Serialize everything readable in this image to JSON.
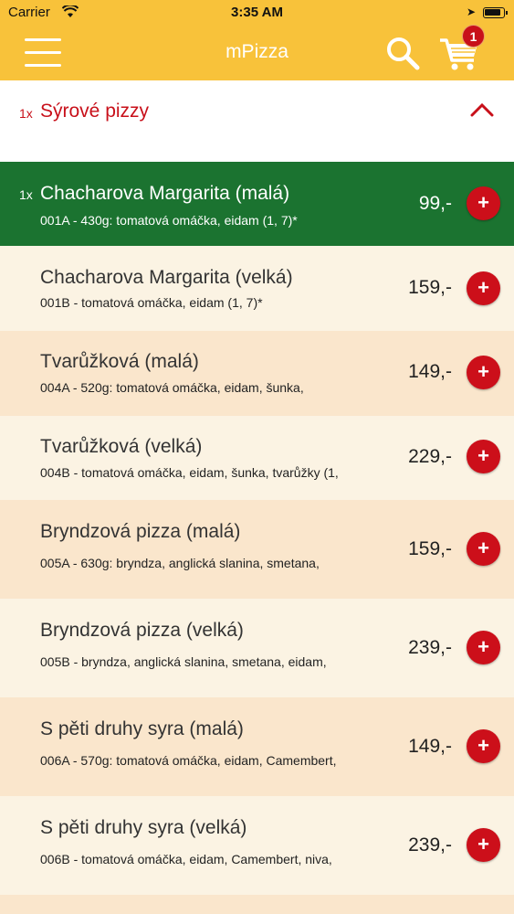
{
  "status": {
    "carrier": "Carrier",
    "time": "3:35 AM"
  },
  "header": {
    "title": "mPizza",
    "cart_count": "1",
    "accent": "#f8c23a"
  },
  "category": {
    "qty": "1x",
    "name": "Sýrové pizzy"
  },
  "items": [
    {
      "qty": "1x",
      "title": "Chacharova Margarita (malá)",
      "desc": "001A - 430g: tomatová omáčka, eidam (1, 7)*",
      "price": "99,-",
      "add": "+"
    },
    {
      "qty": "",
      "title": "Chacharova Margarita (velká)",
      "desc": "001B - tomatová omáčka, eidam (1, 7)*",
      "price": "159,-",
      "add": "+"
    },
    {
      "qty": "",
      "title": "Tvarůžková (malá)",
      "desc": "004A - 520g: tomatová omáčka, eidam, šunka,",
      "price": "149,-",
      "add": "+"
    },
    {
      "qty": "",
      "title": "Tvarůžková (velká)",
      "desc": "004B - tomatová omáčka, eidam, šunka, tvarůžky (1,",
      "price": "229,-",
      "add": "+"
    },
    {
      "qty": "",
      "title": "Bryndzová pizza (malá)",
      "desc": "005A - 630g: bryndza, anglická slanina, smetana,",
      "price": "159,-",
      "add": "+"
    },
    {
      "qty": "",
      "title": "Bryndzová pizza (velká)",
      "desc": "005B - bryndza, anglická slanina, smetana, eidam,",
      "price": "239,-",
      "add": "+"
    },
    {
      "qty": "",
      "title": "S pěti druhy syra (malá)",
      "desc": "006A - 570g: tomatová omáčka, eidam, Camembert,",
      "price": "149,-",
      "add": "+"
    },
    {
      "qty": "",
      "title": "S pěti druhy syra (velká)",
      "desc": "006B - tomatová omáčka, eidam, Camembert, niva,",
      "price": "239,-",
      "add": "+"
    }
  ],
  "colors": {
    "selected_row": "#1b7330",
    "add_button": "#cc0f1a",
    "category_text": "#c8101a"
  }
}
